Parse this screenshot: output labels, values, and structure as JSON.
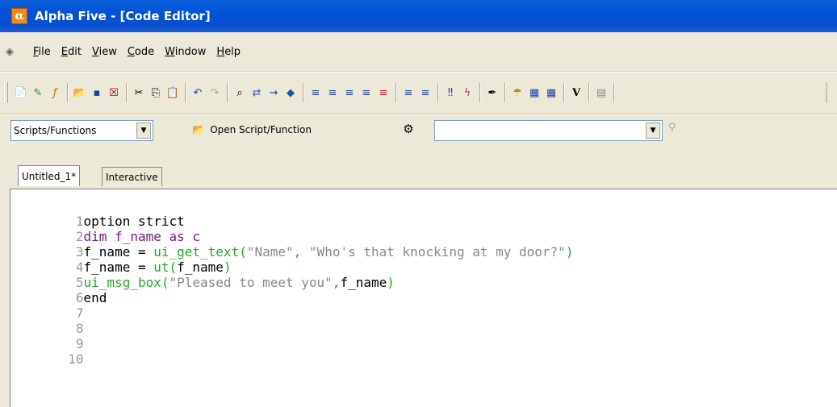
{
  "window": {
    "app_icon_letter": "α",
    "title": "Alpha Five - [Code Editor]"
  },
  "menu": {
    "items": [
      {
        "label": "File",
        "underline": "F"
      },
      {
        "label": "Edit",
        "underline": "E"
      },
      {
        "label": "View",
        "underline": "V"
      },
      {
        "label": "Code",
        "underline": "C"
      },
      {
        "label": "Window",
        "underline": "W"
      },
      {
        "label": "Help",
        "underline": "H"
      }
    ]
  },
  "toolbar": {
    "icons": [
      "new-script-icon",
      "new-function-icon",
      "fx-icon",
      "open-icon",
      "save-icon",
      "close-icon",
      "cut-icon",
      "copy-icon",
      "paste-icon",
      "undo-icon",
      "redo-icon",
      "find-icon",
      "replace-icon",
      "goto-icon",
      "run-icon",
      "align-left-icon",
      "align-center-icon",
      "align-justify-icon",
      "indent-icon",
      "outdent-icon",
      "comment-icon",
      "uncomment-icon",
      "breakpoint-icon",
      "lightning-icon",
      "pen-icon",
      "debug-icon",
      "library-icon",
      "library2-icon",
      "variables-icon",
      "calendar-icon"
    ],
    "variables_glyph": "V"
  },
  "scriptbar": {
    "scripts_select_value": "Scripts/Functions",
    "open_label": "Open Script/Function",
    "combo_value": ""
  },
  "tabs": [
    {
      "label": "Untitled_1*",
      "active": true
    },
    {
      "label": "Interactive",
      "active": false
    }
  ],
  "editor": {
    "lines": [
      {
        "num": "1",
        "text": "option strict"
      },
      {
        "num": "2",
        "text": "dim f_name as c"
      },
      {
        "num": "3",
        "text": "f_name = ui_get_text(\"Name\", \"Who's that knocking at my door?\")"
      },
      {
        "num": "4",
        "text": "f_name = ut(f_name)"
      },
      {
        "num": "5",
        "text": "ui_msg_box(\"Pleased to meet you\",f_name)"
      },
      {
        "num": "6",
        "text": "end"
      },
      {
        "num": "7",
        "text": ""
      },
      {
        "num": "8",
        "text": ""
      },
      {
        "num": "9",
        "text": ""
      },
      {
        "num": "10",
        "text": ""
      }
    ]
  },
  "colors": {
    "title_bar": "#0051d6",
    "keyword_purple": "#7a1a8c",
    "function_green": "#22aa22",
    "string_gray": "#888888"
  }
}
